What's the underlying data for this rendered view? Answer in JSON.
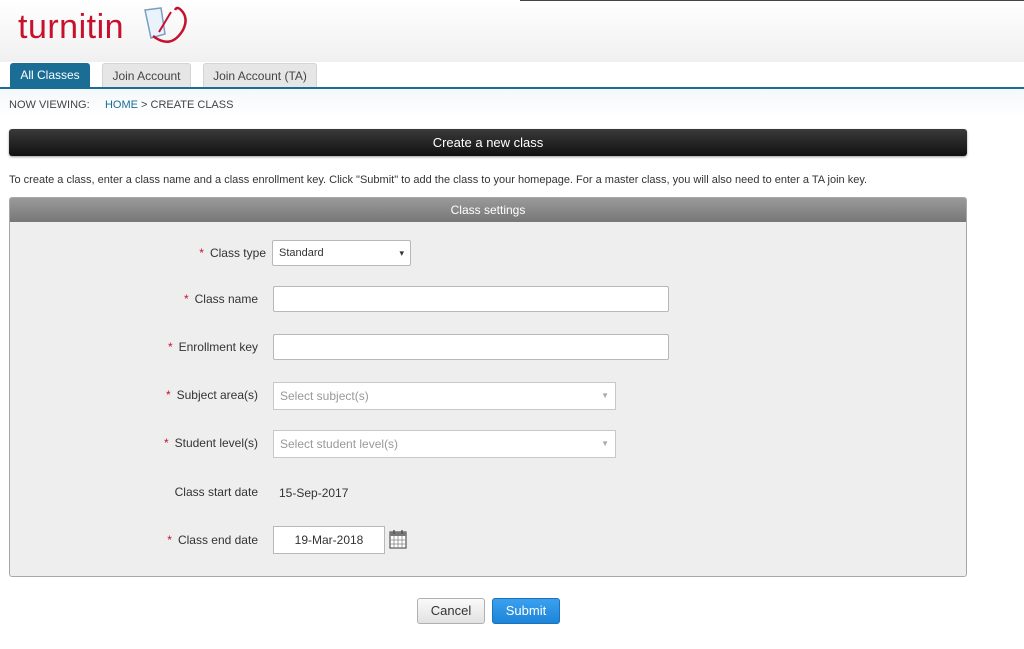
{
  "brand": {
    "logo_text": "turnitin",
    "color": "#c8102e"
  },
  "tabs": [
    {
      "label": "All Classes",
      "active": true
    },
    {
      "label": "Join Account",
      "active": false
    },
    {
      "label": "Join Account (TA)",
      "active": false
    }
  ],
  "breadcrumb": {
    "prefix": "NOW VIEWING:",
    "home": "HOME",
    "separator": ">",
    "current": "CREATE CLASS"
  },
  "page_title": "Create a new class",
  "intro_text": "To create a class, enter a class name and a class enrollment key. Click \"Submit\" to add the class to your homepage. For a master class, you will also need to enter a TA join key.",
  "panel": {
    "title": "Class settings",
    "required_marker": "*",
    "fields": {
      "class_type": {
        "label": "Class type",
        "value": "Standard",
        "arrow": "▾"
      },
      "class_name": {
        "label": "Class name",
        "value": ""
      },
      "enrollment_key": {
        "label": "Enrollment key",
        "value": ""
      },
      "subject_areas": {
        "label": "Subject area(s)",
        "placeholder": "Select subject(s)"
      },
      "student_levels": {
        "label": "Student level(s)",
        "placeholder": "Select student level(s)"
      },
      "start_date": {
        "label": "Class start date",
        "value": "15-Sep-2017"
      },
      "end_date": {
        "label": "Class end date",
        "value": "19-Mar-2018",
        "icon": "calendar-icon"
      }
    }
  },
  "buttons": {
    "cancel": "Cancel",
    "submit": "Submit"
  },
  "colors": {
    "tab_active": "#1a6e96",
    "submit": "#2a92e4",
    "required": "#c8102e"
  }
}
